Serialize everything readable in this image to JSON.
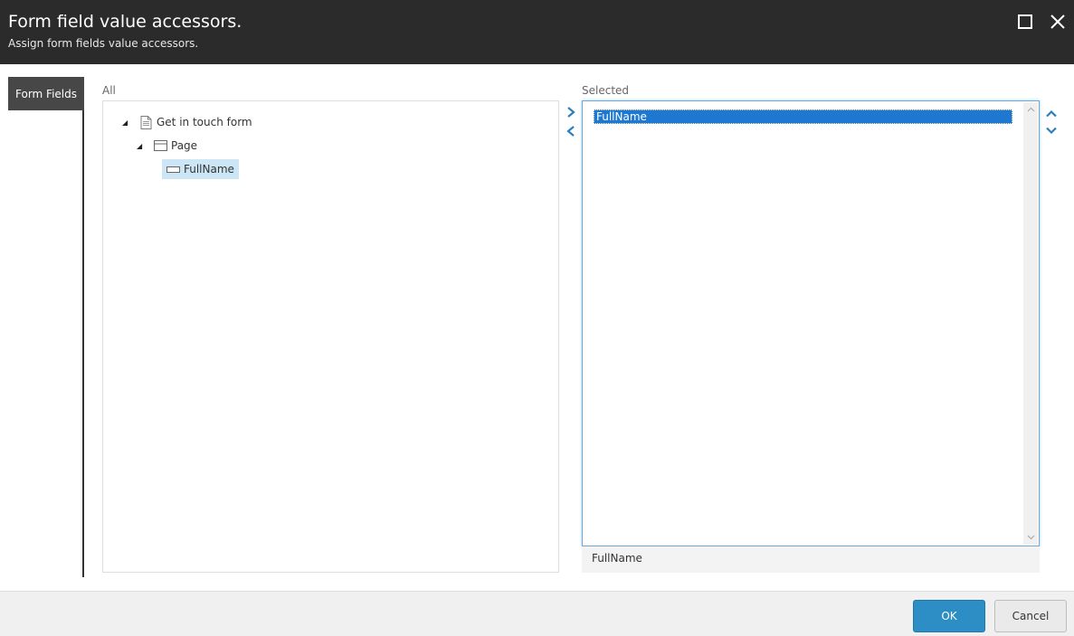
{
  "dialog": {
    "title": "Form field value accessors.",
    "subtitle": "Assign form fields value accessors.",
    "maximize_icon": "maximize-icon",
    "close_icon": "close-icon"
  },
  "tabs": [
    {
      "label": "Form Fields",
      "active": true
    }
  ],
  "all_panel": {
    "label": "All",
    "tree": [
      {
        "label": "Get in touch form",
        "icon": "document-icon",
        "expanded": true
      },
      {
        "label": "Page",
        "icon": "page-icon",
        "expanded": true
      },
      {
        "label": "FullName",
        "icon": "text-field-icon",
        "selected": true
      }
    ]
  },
  "selected_panel": {
    "label": "Selected",
    "items": [
      {
        "label": "FullName",
        "selected": true
      }
    ],
    "footer_value": "FullName"
  },
  "buttons": {
    "ok": "OK",
    "cancel": "Cancel"
  },
  "colors": {
    "header_bg": "#2b2b2b",
    "accent": "#2c8ec4",
    "selection": "#1e78d0",
    "tree_selection": "#cde6f5"
  }
}
